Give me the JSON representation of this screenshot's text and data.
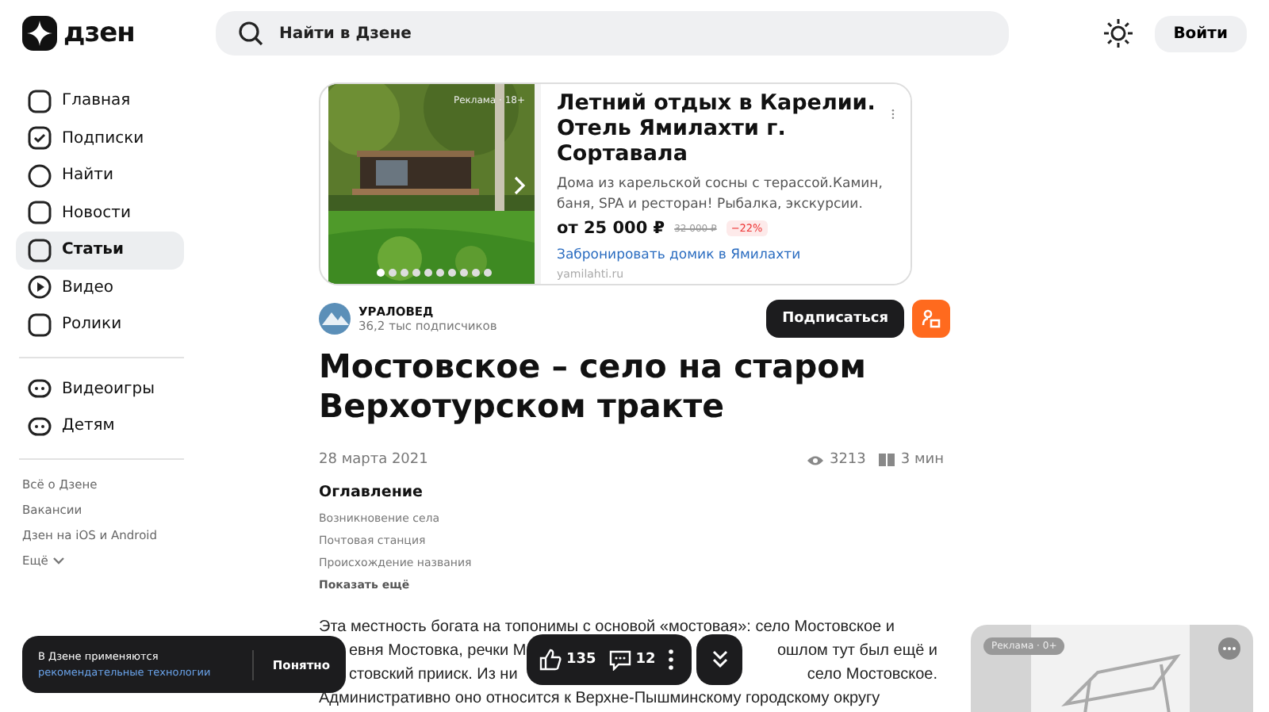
{
  "header": {
    "logo": "дзен",
    "search": {
      "placeholder": "Найти в Дзене"
    },
    "login": "Войти"
  },
  "sidebar": {
    "items": [
      {
        "label": "Главная",
        "selected": false
      },
      {
        "label": "Подписки",
        "selected": false
      },
      {
        "label": "Найти",
        "selected": false
      },
      {
        "label": "Новости",
        "selected": false
      },
      {
        "label": "Статьи",
        "selected": true
      },
      {
        "label": "Видео",
        "selected": false
      },
      {
        "label": "Ролики",
        "selected": false
      }
    ],
    "extra_items": [
      {
        "label": "Видеоигры",
        "selected": false
      },
      {
        "label": "Детям",
        "selected": false
      }
    ],
    "links": [
      "Всё о Дзене",
      "Вакансии",
      "Дзен на iOS и Android"
    ],
    "more": "Ещё"
  },
  "ad": {
    "badge": "Реклама · 18+",
    "title": "Летний отдых в Карелии. Отель Ямилахти г. Сортавала",
    "text": "Дома из карельской сосны с терассой.Камин, баня, SPA и ресторан! Рыбалка, экскурсии.",
    "price": "от 25 000 ₽",
    "old_price": "32 000 ₽",
    "discount": "−22%",
    "link": "Забронировать домик в Ямилахти",
    "domain": "yamilahti.ru"
  },
  "channel": {
    "name": "УРАЛОВЕД",
    "subscribers": "36,2 тыс подписчиков",
    "subscribe": "Подписаться"
  },
  "article": {
    "title": "Мостовское – село на старом Верхотурском тракте",
    "date": "28 марта 2021",
    "views": "3213",
    "read_time": "3 мин",
    "toc": {
      "heading": "Оглавление",
      "items": [
        "Возникновение села",
        "Почтовая станция",
        "Происхождение названия"
      ],
      "more": "Показать ещё"
    },
    "lines": [
      {
        "left": "Эта местность богата на топонимы с основой «мостовая»: село Мостовское и"
      },
      {
        "left": "евня Мостовка, речки М",
        "right": "ошлом тут был ещё и"
      },
      {
        "left": "стовский прииск. Из ни",
        "right": "село Мостовское."
      },
      {
        "left": "Административно оно относится к Верхне-Пышминскому городскому округу"
      }
    ]
  },
  "cookie": {
    "text": "В Дзене применяются",
    "link": "рекомендательные технологии",
    "button": "Понятно"
  },
  "actions": {
    "likes": "135",
    "comments": "12"
  },
  "side_ad": {
    "badge": "Реклама · 0+"
  }
}
